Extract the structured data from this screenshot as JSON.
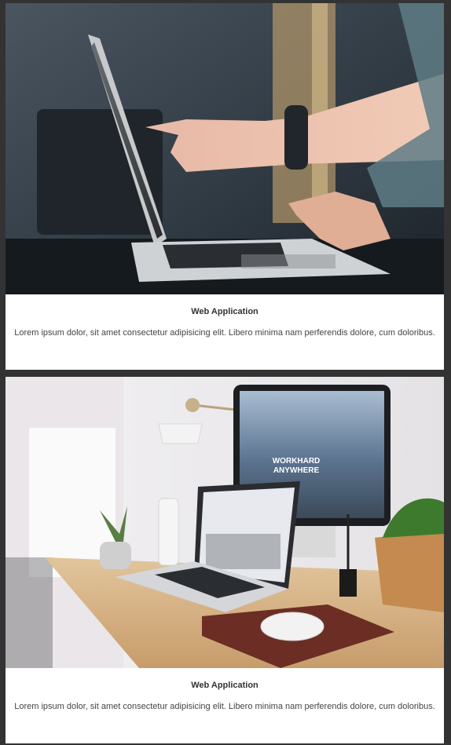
{
  "cards": [
    {
      "title": "Web Application",
      "text": "Lorem ipsum dolor, sit amet consectetur adipisicing elit. Libero minima nam perferendis dolore, cum doloribus.",
      "image_subject": "hands pointing at laptop screen"
    },
    {
      "title": "Web Application",
      "text": "Lorem ipsum dolor, sit amet consectetur adipisicing elit. Libero minima nam perferendis dolore, cum doloribus.",
      "image_subject": "desk with laptop and monitor",
      "monitor_text": "WORKHARD\nANYWHERE"
    }
  ]
}
